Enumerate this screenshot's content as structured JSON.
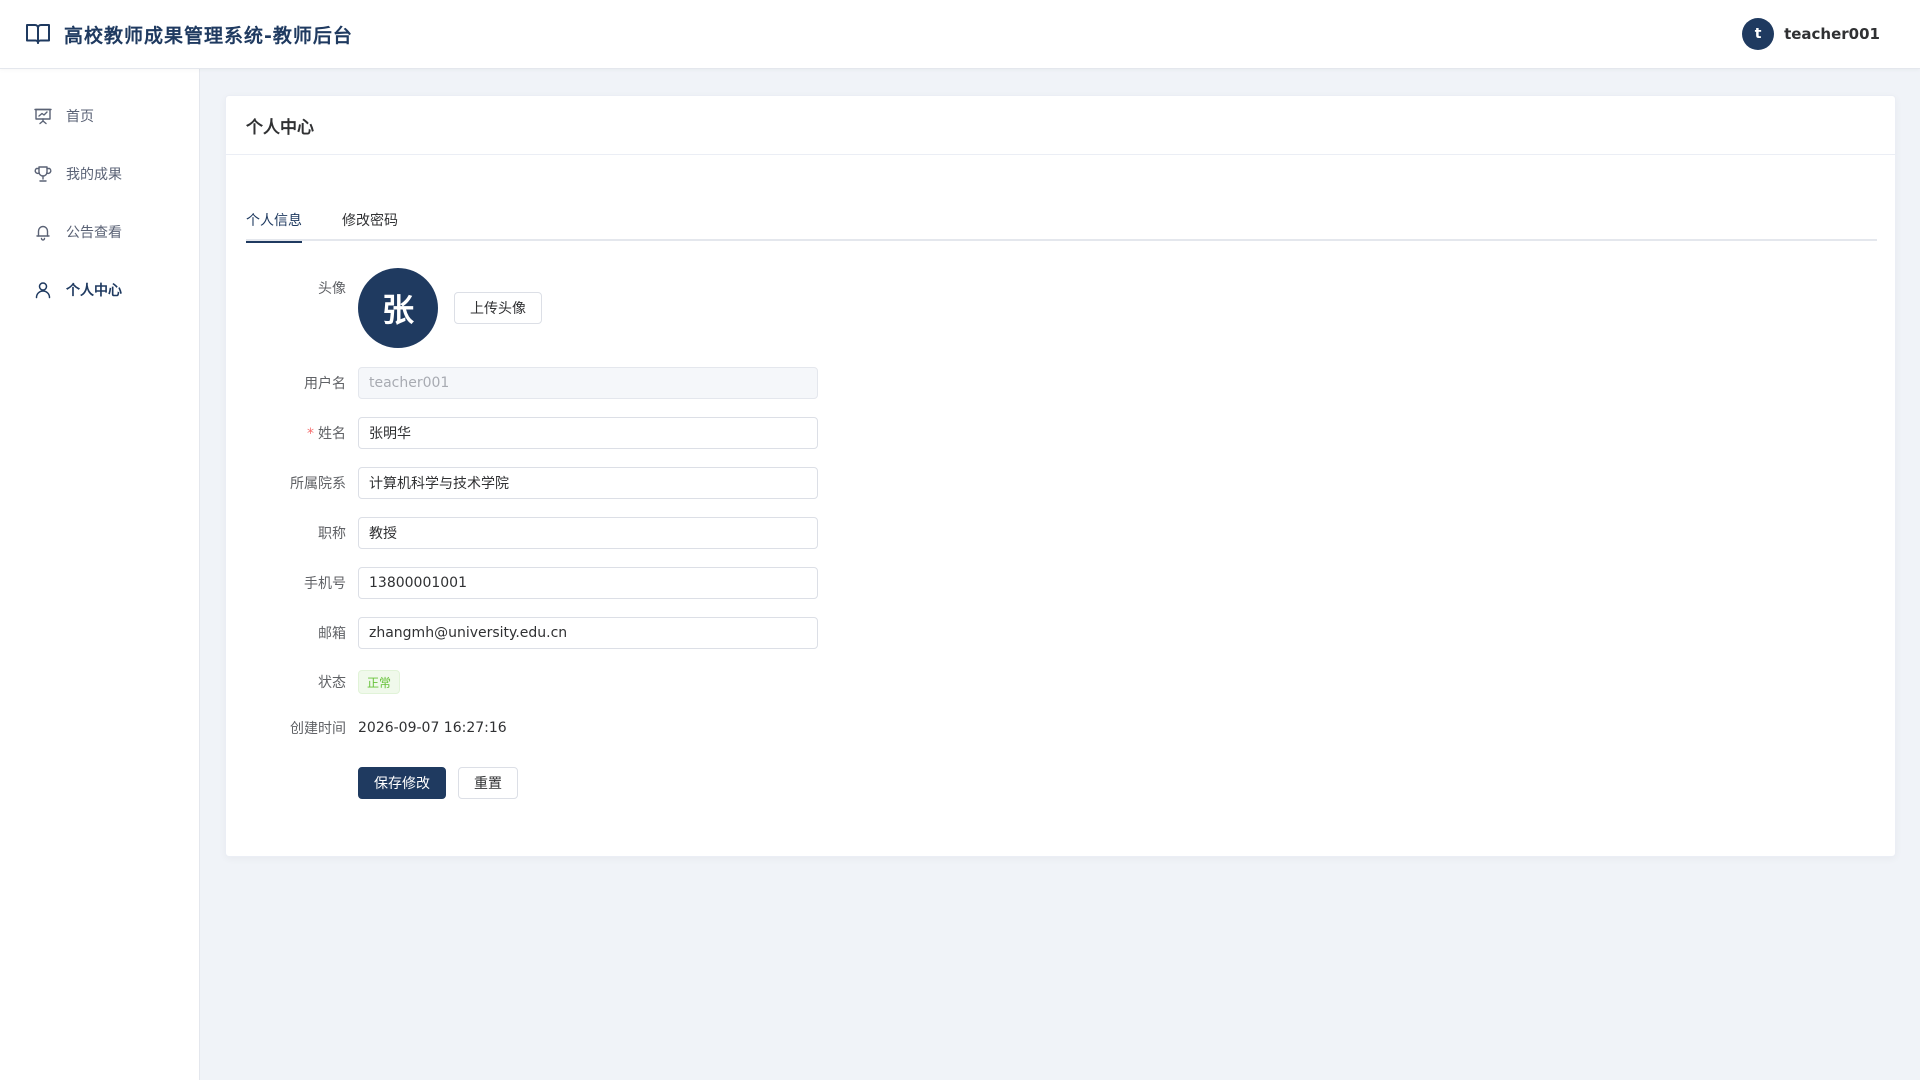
{
  "header": {
    "title": "高校教师成果管理系统-教师后台",
    "brand_icon": "book-open-icon",
    "user_initial": "t",
    "username": "teacher001"
  },
  "sidebar": {
    "items": [
      {
        "label": "首页",
        "icon": "presentation-chart-icon",
        "active": false
      },
      {
        "label": "我的成果",
        "icon": "trophy-icon",
        "active": false
      },
      {
        "label": "公告查看",
        "icon": "bell-icon",
        "active": false
      },
      {
        "label": "个人中心",
        "icon": "user-icon",
        "active": true
      }
    ]
  },
  "page": {
    "title": "个人中心",
    "tabs": [
      {
        "label": "个人信息",
        "active": true
      },
      {
        "label": "修改密码",
        "active": false
      }
    ]
  },
  "form": {
    "avatar_label": "头像",
    "avatar_char": "张",
    "upload_button": "上传头像",
    "username_label": "用户名",
    "username_value": "teacher001",
    "name_required_mark": "*",
    "name_label": "姓名",
    "name_value": "张明华",
    "department_label": "所属院系",
    "department_value": "计算机科学与技术学院",
    "title_label": "职称",
    "title_value": "教授",
    "phone_label": "手机号",
    "phone_value": "13800001001",
    "email_label": "邮箱",
    "email_value": "zhangmh@university.edu.cn",
    "status_label": "状态",
    "status_value": "正常",
    "created_label": "创建时间",
    "created_value": "2026-09-07 16:27:16",
    "save_button": "保存修改",
    "reset_button": "重置"
  },
  "colors": {
    "primary": "#1f3a60",
    "success": "#67c23a",
    "background": "#f0f3f8"
  }
}
